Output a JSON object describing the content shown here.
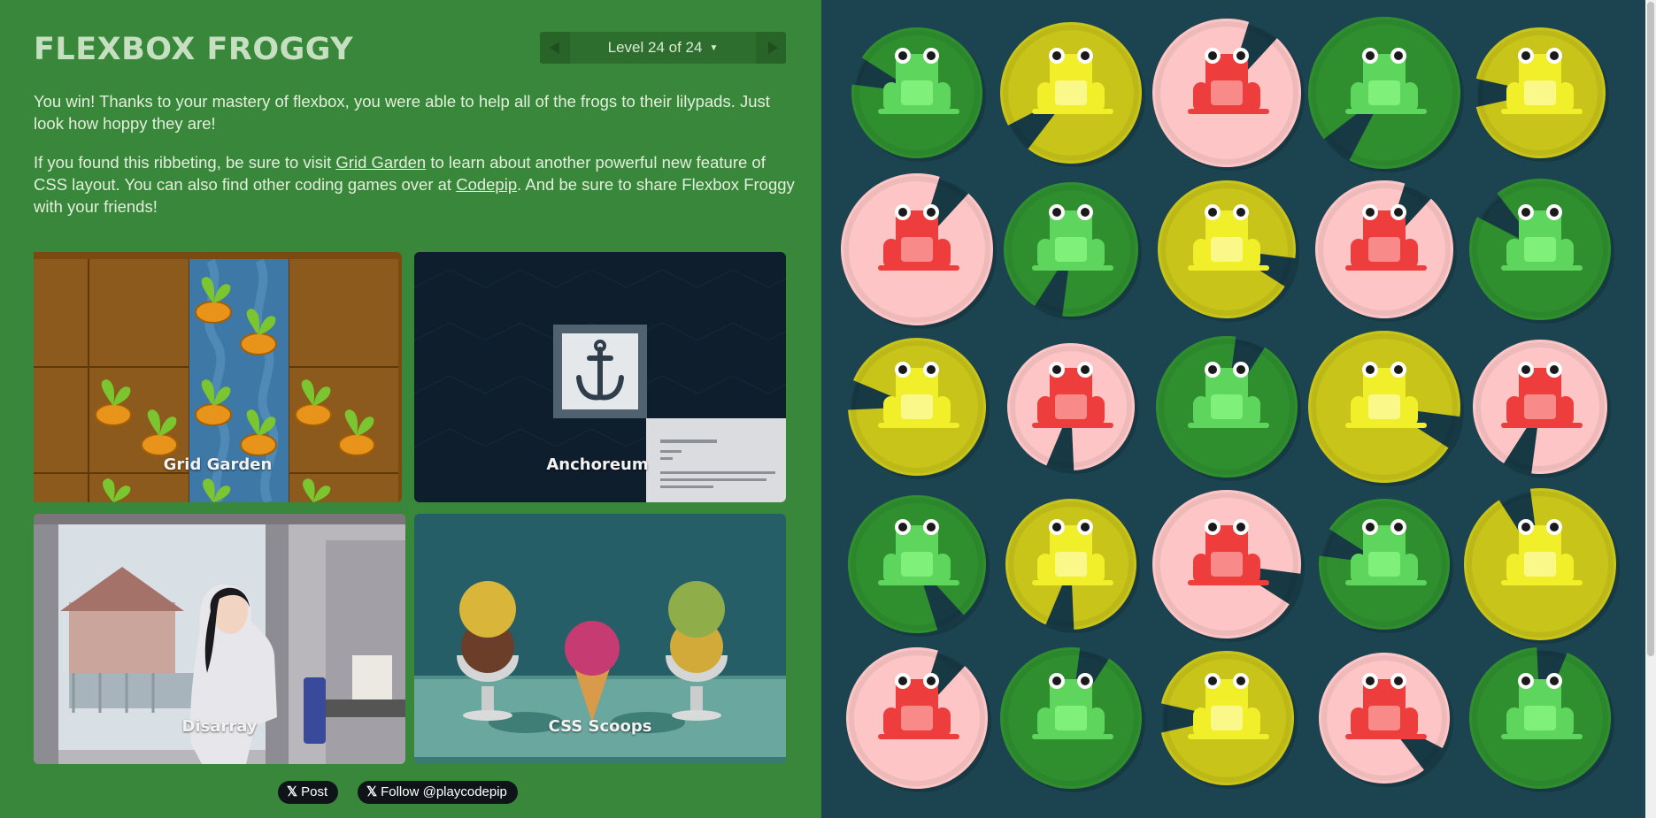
{
  "header": {
    "title": "FLEXBOX FROGGY",
    "level_text": "Level 24 of 24",
    "caret": "▼"
  },
  "message": {
    "para1": "You win! Thanks to your mastery of flexbox, you were able to help all of the frogs to their lilypads. Just look how hoppy they are!",
    "para2_a": "If you found this ribbeting, be sure to visit ",
    "link_grid_garden": "Grid Garden",
    "para2_b": " to learn about another powerful new feature of CSS layout. You can also find other coding games over at ",
    "link_codepip": "Codepip",
    "para2_c": ". And be sure to share Flexbox Froggy with your friends!"
  },
  "games": [
    {
      "name": "Grid Garden"
    },
    {
      "name": "Anchoreum"
    },
    {
      "name": "Disarray"
    },
    {
      "name": "CSS Scoops"
    }
  ],
  "share": {
    "post_label": "Post",
    "follow_label": "Follow @playcodepip",
    "x_glyph": "𝕏"
  },
  "board": {
    "colors": {
      "green": {
        "pad": "#2f8f2e",
        "frog": "#5ed65d",
        "belly": "#7ff07a"
      },
      "yellow": {
        "pad": "#c8c41a",
        "frog": "#f1ee2a",
        "belly": "#fbf88a"
      },
      "red": {
        "pad": "#fdc5c5",
        "frog": "#ee3d3d",
        "belly": "#f98a8a"
      }
    },
    "rows": [
      [
        "green",
        "yellow",
        "red",
        "green",
        "yellow"
      ],
      [
        "red",
        "green",
        "yellow",
        "red",
        "green"
      ],
      [
        "yellow",
        "red",
        "green",
        "yellow",
        "red"
      ],
      [
        "green",
        "yellow",
        "red",
        "green",
        "yellow"
      ],
      [
        "red",
        "green",
        "yellow",
        "red",
        "green"
      ]
    ]
  }
}
